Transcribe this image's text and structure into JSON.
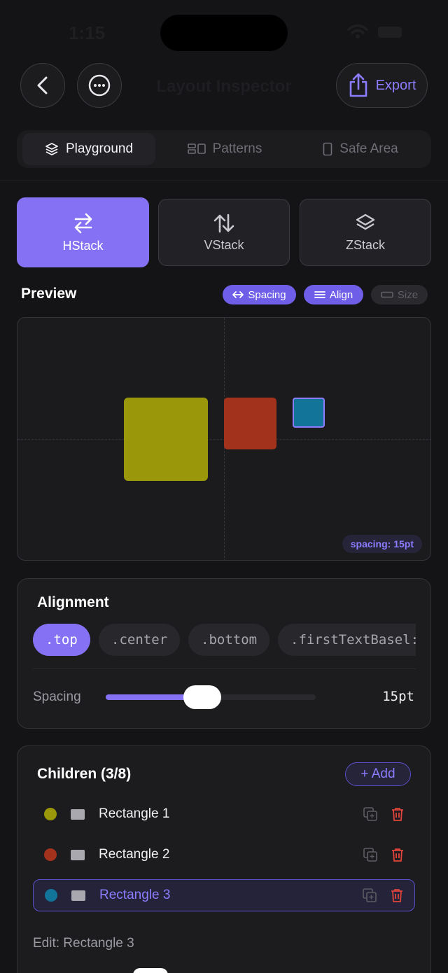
{
  "status": {
    "time": "1:15"
  },
  "header": {
    "title": "Layout Inspector",
    "export_label": "Export"
  },
  "tabs": [
    {
      "label": "Playground",
      "icon": "layers-icon",
      "active": true
    },
    {
      "label": "Patterns",
      "icon": "patterns-icon",
      "active": false
    },
    {
      "label": "Safe Area",
      "icon": "phone-icon",
      "active": false
    }
  ],
  "stacks": [
    {
      "label": "HStack",
      "icon": "arrows-left-right-icon",
      "active": true
    },
    {
      "label": "VStack",
      "icon": "arrows-up-down-icon",
      "active": false
    },
    {
      "label": "ZStack",
      "icon": "layers-icon",
      "active": false
    }
  ],
  "preview": {
    "title": "Preview",
    "toggles": [
      {
        "label": "Spacing",
        "icon": "arrows-horizontal-icon",
        "on": true
      },
      {
        "label": "Align",
        "icon": "lines-icon",
        "on": true
      },
      {
        "label": "Size",
        "icon": "ruler-icon",
        "on": false
      }
    ],
    "spacing_badge": "spacing: 15pt"
  },
  "alignment": {
    "title": "Alignment",
    "options": [
      ".top",
      ".center",
      ".bottom",
      ".firstTextBasel:"
    ],
    "selected": ".top",
    "spacing_label": "Spacing",
    "spacing_value_text": "15pt",
    "spacing_slider_fraction": 0.45
  },
  "children": {
    "title": "Children (3/8)",
    "add_label": "+ Add",
    "items": [
      {
        "label": "Rectangle 1",
        "color": "#9a970a",
        "selected": false
      },
      {
        "label": "Rectangle 2",
        "color": "#a3321c",
        "selected": false
      },
      {
        "label": "Rectangle 3",
        "color": "#13749a",
        "selected": true
      }
    ],
    "edit_label": "Edit: Rectangle 3"
  },
  "colors": {
    "accent": "#8571f3",
    "background": "#141416",
    "card": "#1c1c1f",
    "danger": "#e0443a"
  }
}
